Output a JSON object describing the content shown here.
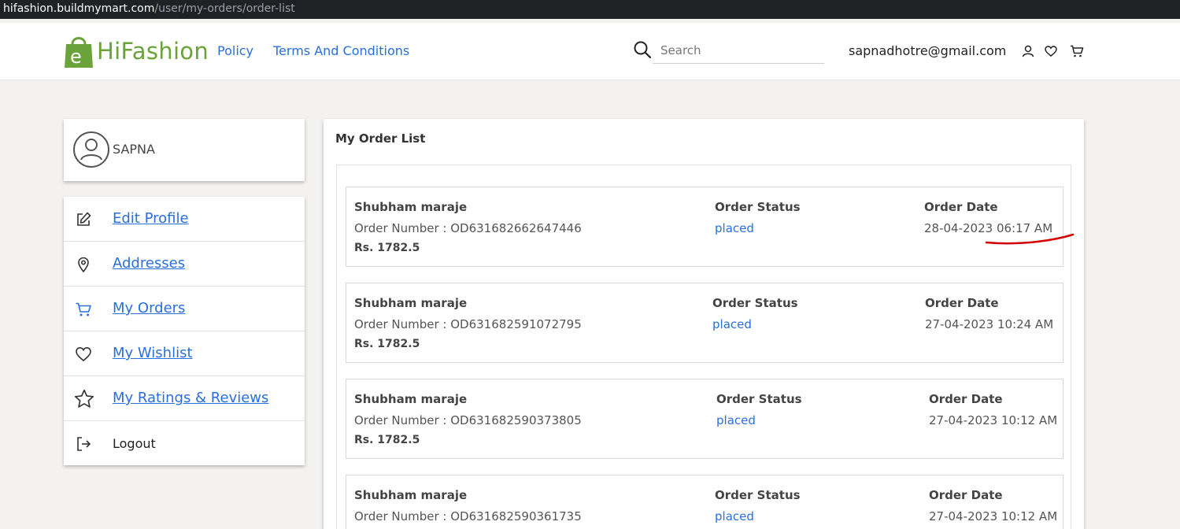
{
  "browser": {
    "host": "hifashion.buildmymart.com",
    "path": "/user/my-orders/order-list"
  },
  "header": {
    "logo_letter": "e",
    "logo_text": "HiFashion",
    "nav": [
      {
        "label": "Policy"
      },
      {
        "label": "Terms And Conditions"
      }
    ],
    "search_placeholder": "Search",
    "email": "sapnadhotre@gmail.com"
  },
  "profile": {
    "name": "SAPNA"
  },
  "menu": [
    {
      "label": "Edit Profile",
      "icon": "edit-icon"
    },
    {
      "label": "Addresses",
      "icon": "location-pin-icon"
    },
    {
      "label": "My Orders",
      "icon": "cart-icon"
    },
    {
      "label": "My Wishlist",
      "icon": "heart-icon"
    },
    {
      "label": "My Ratings & Reviews",
      "icon": "star-icon"
    },
    {
      "label": "Logout",
      "icon": "logout-icon"
    }
  ],
  "orders_panel": {
    "title": "My Order List",
    "status_header": "Order Status",
    "date_header": "Order Date",
    "orders": [
      {
        "customer": "Shubham maraje",
        "number": "Order Number : OD631682662647446",
        "amount": "Rs. 1782.5",
        "status": "placed",
        "date": "28-04-2023 06:17 AM"
      },
      {
        "customer": "Shubham maraje",
        "number": "Order Number : OD631682591072795",
        "amount": "Rs. 1782.5",
        "status": "placed",
        "date": "27-04-2023 10:24 AM"
      },
      {
        "customer": "Shubham maraje",
        "number": "Order Number : OD631682590373805",
        "amount": "Rs. 1782.5",
        "status": "placed",
        "date": "27-04-2023 10:12 AM"
      },
      {
        "customer": "Shubham maraje",
        "number": "Order Number : OD631682590361735",
        "amount": "",
        "status": "placed",
        "date": "27-04-2023 10:12 AM"
      }
    ]
  },
  "colors": {
    "link": "#2a6fdb",
    "brand": "#6aa33a",
    "annotation": "#d40000"
  }
}
